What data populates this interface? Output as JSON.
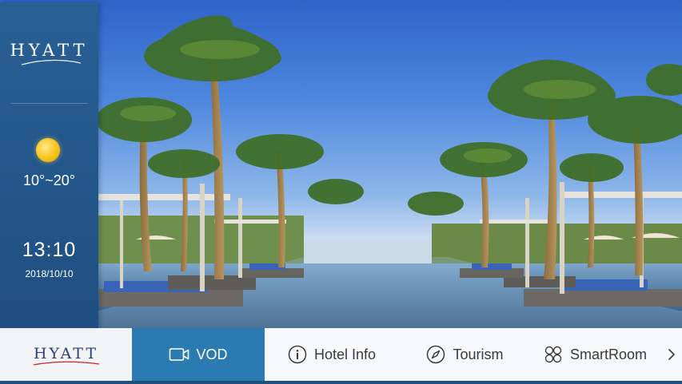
{
  "sidebar": {
    "brand": "HYATT",
    "weather_icon": "sun-icon",
    "temperature": "10°~20°",
    "time": "13:10",
    "date": "2018/10/10"
  },
  "menu": {
    "brand": "HYATT",
    "items": [
      {
        "label": "VOD",
        "icon": "video-camera-icon",
        "active": true
      },
      {
        "label": "Hotel Info",
        "icon": "info-icon",
        "active": false
      },
      {
        "label": "Tourism",
        "icon": "compass-icon",
        "active": false
      },
      {
        "label": "SmartRoom",
        "icon": "grid-icon",
        "active": false
      }
    ],
    "next_icon": "chevron-right-icon"
  },
  "colors": {
    "sidebar": "#24588c",
    "menu_active": "#2a7bb2",
    "menu_bg": "#f7f8fa",
    "brand_text": "#2d3f7a"
  }
}
